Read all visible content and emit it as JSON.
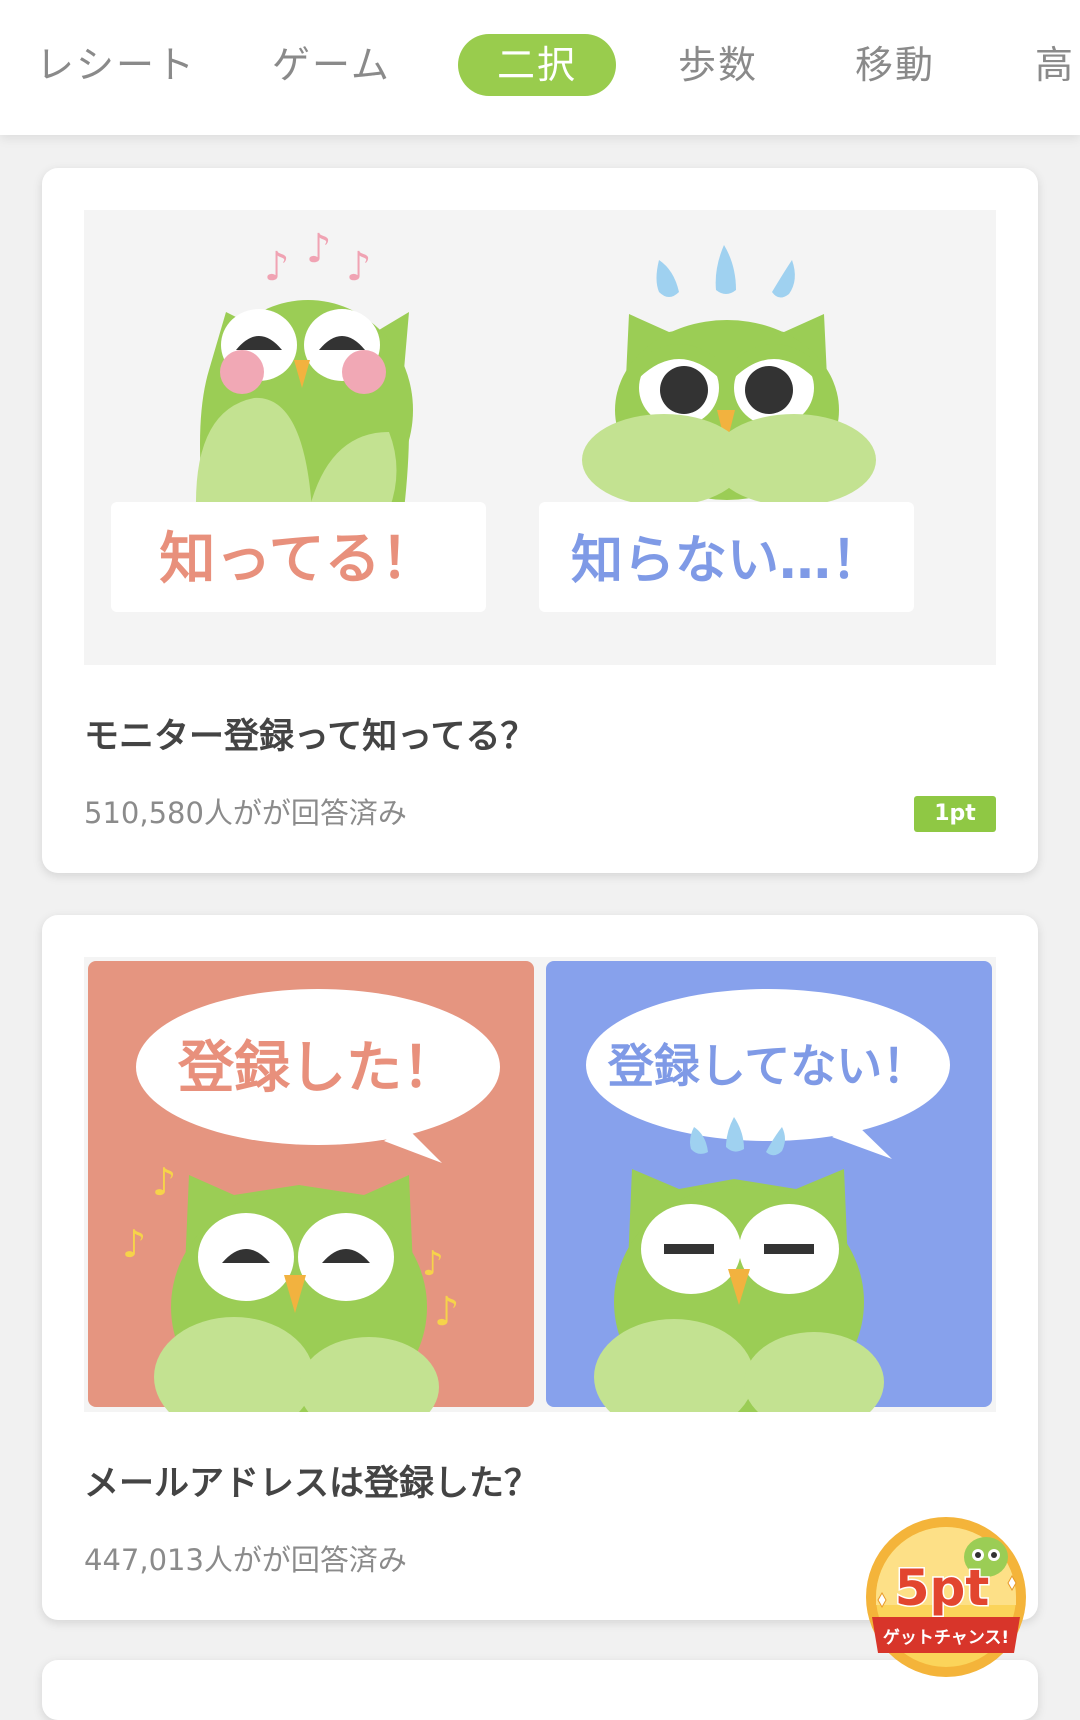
{
  "tabs": [
    "レシート",
    "ゲーム",
    "二択",
    "歩数",
    "移動",
    "高"
  ],
  "active_tab": "二択",
  "cards": [
    {
      "left_label": "知ってる！",
      "right_label": "知らない…！",
      "question": "モニター登録って知ってる？",
      "answer_count": "510,580人がが回答済み",
      "points": "1pt"
    },
    {
      "left_label": "登録した！",
      "right_label": "登録してない！",
      "question": "メールアドレスは登録した？",
      "answer_count": "447,013人がが回答済み"
    }
  ],
  "bonus_badge": {
    "points": "5pt",
    "caption": "ゲットチャンス!"
  },
  "colors": {
    "accent": "#99cc4d",
    "owl_green": "#9bcd55",
    "owl_belly": "#c3e291",
    "known_red": "#e8907c",
    "unknown_blue": "#7f9ae6",
    "panel_red": "#e59580",
    "panel_blue": "#87a1ec"
  }
}
